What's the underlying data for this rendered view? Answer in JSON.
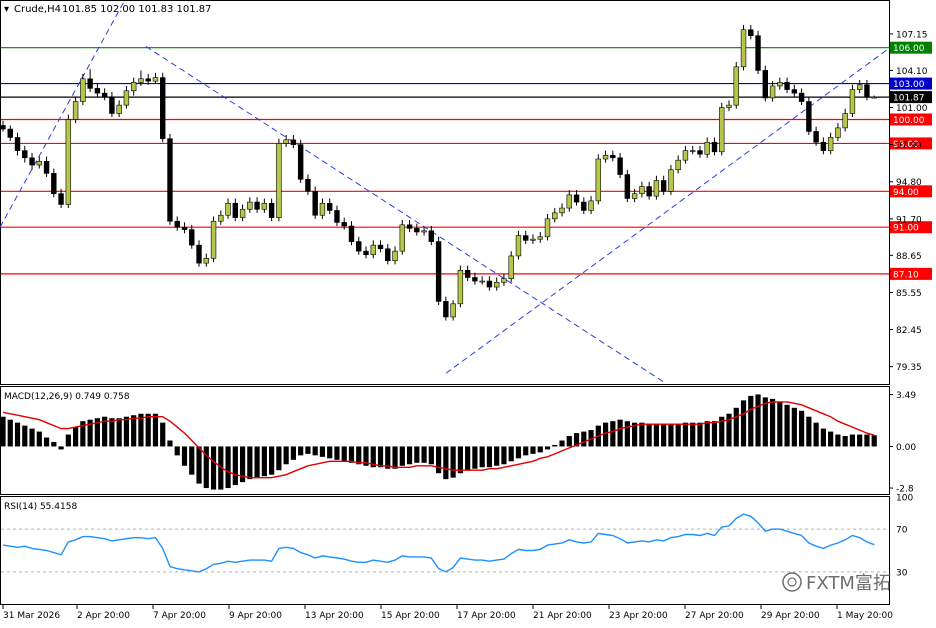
{
  "header": {
    "symbol": "Crude,H4",
    "ohlc": "101.85 102.00 101.83 101.87"
  },
  "watermark": "FXTM富拓",
  "colors": {
    "bull": "#b5c64a",
    "bear": "#000000",
    "support_line": "#ff0000",
    "top_line": "#008000",
    "blue_line": "#0000c8",
    "trend_line": "#2a3ee0",
    "macd_signal": "#e00000",
    "rsi": "#1e90ff"
  },
  "chart_data": [
    {
      "id": "price",
      "type": "candlestick",
      "ylim": [
        77.9,
        109.9
      ],
      "y_ticks": [
        "107.15",
        "104.10",
        "101.00",
        "97.90",
        "94.80",
        "91.70",
        "88.65",
        "85.55",
        "82.45",
        "79.35"
      ],
      "x_ticks": [
        "31 Mar 2026",
        "2 Apr 20:00",
        "7 Apr 20:00",
        "9 Apr 20:00",
        "13 Apr 20:00",
        "15 Apr 20:00",
        "17 Apr 20:00",
        "21 Apr 20:00",
        "23 Apr 20:00",
        "27 Apr 20:00",
        "29 Apr 20:00",
        "1 May 20:00"
      ],
      "close": [
        99.2,
        98.5,
        97.4,
        96.8,
        96.2,
        96.5,
        95.5,
        93.8,
        92.9,
        100.0,
        101.5,
        103.4,
        102.6,
        102.2,
        101.9,
        100.5,
        101.2,
        102.4,
        103.1,
        103.4,
        103.2,
        103.5,
        98.4,
        91.5,
        91.0,
        90.8,
        89.5,
        88.0,
        88.4,
        91.5,
        92.0,
        93.0,
        91.8,
        92.5,
        93.1,
        92.5,
        93.0,
        91.8,
        98.0,
        98.3,
        97.9,
        95.0,
        94.0,
        92.0,
        93.0,
        92.4,
        91.4,
        91.1,
        89.8,
        89.0,
        88.7,
        89.5,
        89.2,
        88.2,
        89.0,
        91.2,
        90.9,
        90.6,
        90.7,
        89.8,
        84.8,
        83.5,
        84.6,
        87.4,
        86.8,
        86.5,
        86.5,
        86.0,
        86.4,
        86.7,
        88.6,
        90.3,
        89.9,
        90.0,
        90.2,
        91.7,
        92.2,
        92.6,
        93.7,
        93.1,
        92.4,
        93.2,
        96.7,
        97.0,
        96.8,
        95.4,
        93.4,
        93.8,
        94.4,
        93.6,
        94.9,
        94.0,
        95.8,
        96.6,
        97.4,
        97.4,
        97.1,
        98.1,
        97.3,
        101.0,
        101.2,
        104.4,
        107.5,
        107.0,
        104.1,
        101.8,
        102.8,
        103.1,
        102.5,
        102.2,
        101.5,
        99.0,
        98.1,
        97.4,
        98.5,
        99.3,
        100.5,
        102.5,
        102.9,
        101.9,
        101.87
      ],
      "open": [
        99.5,
        99.2,
        98.5,
        97.4,
        96.8,
        96.2,
        96.5,
        95.5,
        93.8,
        92.9,
        100.0,
        101.5,
        103.4,
        102.6,
        102.2,
        101.9,
        100.5,
        101.2,
        102.4,
        103.1,
        103.4,
        103.2,
        103.5,
        98.4,
        91.5,
        91.0,
        90.8,
        89.5,
        88.0,
        88.4,
        91.5,
        92.0,
        93.0,
        91.8,
        92.5,
        93.1,
        92.5,
        93.0,
        91.8,
        98.0,
        98.3,
        97.9,
        95.0,
        94.0,
        92.0,
        93.0,
        92.4,
        91.4,
        91.1,
        89.8,
        89.0,
        88.7,
        89.5,
        89.2,
        88.2,
        89.0,
        91.2,
        90.9,
        90.6,
        90.7,
        89.8,
        84.8,
        83.5,
        84.6,
        87.4,
        86.8,
        86.5,
        86.5,
        86.0,
        86.4,
        86.7,
        88.6,
        90.3,
        89.9,
        90.0,
        90.2,
        91.7,
        92.2,
        92.6,
        93.7,
        93.1,
        92.4,
        93.2,
        96.7,
        97.0,
        96.8,
        95.4,
        93.4,
        93.8,
        94.4,
        93.6,
        94.9,
        94.0,
        95.8,
        96.6,
        97.4,
        97.4,
        97.1,
        98.1,
        97.3,
        101.0,
        101.2,
        104.4,
        107.5,
        107.0,
        104.1,
        101.8,
        102.8,
        103.1,
        102.5,
        102.2,
        101.5,
        99.0,
        98.1,
        97.4,
        98.5,
        99.3,
        100.5,
        102.5,
        102.9,
        101.85
      ],
      "high": [
        99.9,
        99.5,
        98.9,
        97.8,
        97.2,
        96.9,
        96.9,
        95.9,
        94.2,
        100.4,
        101.9,
        103.8,
        104.2,
        103.0,
        102.6,
        102.3,
        101.6,
        102.8,
        103.5,
        104.1,
        103.8,
        103.9,
        103.9,
        98.8,
        91.9,
        91.4,
        91.2,
        89.9,
        88.8,
        91.9,
        92.4,
        93.4,
        93.4,
        92.9,
        93.5,
        93.5,
        93.4,
        93.4,
        98.4,
        98.7,
        98.7,
        98.3,
        95.4,
        94.4,
        93.4,
        93.4,
        92.8,
        91.8,
        91.5,
        90.2,
        89.4,
        89.9,
        89.9,
        89.6,
        89.4,
        91.6,
        91.6,
        91.3,
        91.0,
        91.1,
        90.2,
        85.2,
        84.9,
        87.8,
        87.8,
        87.2,
        86.9,
        86.9,
        86.8,
        87.1,
        89.0,
        90.7,
        90.7,
        90.4,
        90.6,
        92.1,
        92.6,
        93.0,
        94.1,
        94.1,
        93.5,
        93.6,
        97.1,
        97.4,
        97.4,
        97.2,
        95.8,
        94.2,
        94.8,
        94.8,
        95.3,
        95.3,
        96.2,
        97.0,
        97.8,
        97.8,
        97.8,
        98.5,
        98.5,
        101.4,
        101.6,
        104.8,
        107.9,
        107.9,
        107.4,
        104.5,
        103.2,
        103.5,
        103.5,
        102.9,
        102.6,
        101.9,
        99.4,
        98.5,
        98.9,
        99.7,
        100.9,
        102.9,
        103.3,
        103.3,
        102.0
      ],
      "low": [
        99.0,
        98.2,
        97.0,
        96.4,
        95.8,
        95.9,
        95.2,
        93.5,
        92.6,
        92.6,
        99.7,
        101.2,
        102.3,
        101.9,
        101.6,
        100.2,
        100.2,
        100.9,
        102.0,
        102.8,
        102.9,
        103.0,
        98.1,
        91.2,
        90.7,
        90.5,
        89.2,
        87.7,
        87.7,
        88.1,
        91.2,
        91.7,
        91.5,
        91.5,
        92.2,
        92.2,
        92.2,
        91.5,
        91.5,
        97.7,
        97.6,
        94.7,
        93.7,
        91.7,
        91.7,
        92.1,
        91.1,
        90.8,
        89.5,
        88.7,
        88.4,
        88.4,
        88.9,
        87.9,
        87.9,
        88.7,
        90.6,
        90.3,
        90.3,
        89.5,
        84.5,
        83.2,
        83.2,
        84.3,
        86.5,
        86.2,
        86.2,
        85.7,
        85.7,
        86.1,
        86.4,
        88.3,
        89.6,
        89.6,
        89.7,
        89.9,
        91.4,
        91.9,
        92.3,
        92.8,
        92.1,
        92.1,
        92.9,
        96.4,
        96.5,
        95.1,
        93.1,
        93.1,
        93.5,
        93.3,
        93.3,
        93.7,
        93.7,
        95.5,
        96.3,
        97.1,
        96.8,
        96.8,
        97.0,
        97.0,
        100.7,
        100.9,
        104.1,
        106.7,
        103.8,
        101.5,
        101.5,
        102.5,
        102.2,
        101.9,
        101.2,
        98.7,
        97.8,
        97.1,
        97.1,
        98.2,
        99.0,
        100.2,
        102.2,
        101.6,
        101.83
      ],
      "h_levels": [
        {
          "label": "106.00",
          "value": 106.0,
          "color": "#008000"
        },
        {
          "label": "103.00",
          "value": 103.0,
          "color": "#0000c8"
        },
        {
          "label": "101.87",
          "value": 101.87,
          "color": "#000000"
        },
        {
          "label": "100.00",
          "value": 100.0,
          "color": "#ff0000"
        },
        {
          "label": "98.00",
          "value": 98.0,
          "color": "#ff0000"
        },
        {
          "label": "94.00",
          "value": 94.0,
          "color": "#ff0000"
        },
        {
          "label": "91.00",
          "value": 91.0,
          "color": "#ff0000"
        },
        {
          "label": "87.10",
          "value": 87.1,
          "color": "#ff0000"
        }
      ],
      "trendlines": [
        {
          "from": [
            0,
            91.0
          ],
          "to": [
            129,
            110.6
          ]
        },
        {
          "from": [
            146,
            106.1
          ],
          "to": [
            665,
            78.0
          ]
        },
        {
          "from": [
            446,
            78.8
          ],
          "to": [
            890,
            106.0
          ]
        }
      ]
    },
    {
      "id": "macd",
      "type": "bar+line",
      "title": "MACD(12,26,9) 0.749 0.758",
      "ylim": [
        -3.2,
        4.0
      ],
      "y_ticks": [
        "3.49",
        "0.00",
        "-2.8"
      ],
      "histogram": [
        2.0,
        1.8,
        1.6,
        1.4,
        1.2,
        1.0,
        0.6,
        0.3,
        -0.2,
        0.8,
        1.3,
        1.7,
        1.8,
        1.9,
        2.0,
        1.9,
        1.9,
        2.0,
        2.1,
        2.2,
        2.2,
        2.2,
        1.6,
        0.4,
        -0.6,
        -1.3,
        -1.9,
        -2.5,
        -2.8,
        -2.9,
        -2.9,
        -2.8,
        -2.6,
        -2.4,
        -2.2,
        -2.1,
        -2.0,
        -1.9,
        -1.6,
        -1.2,
        -0.9,
        -0.6,
        -0.5,
        -0.6,
        -0.7,
        -0.8,
        -0.9,
        -1.0,
        -1.1,
        -1.2,
        -1.3,
        -1.4,
        -1.4,
        -1.5,
        -1.5,
        -1.3,
        -1.2,
        -1.1,
        -1.1,
        -1.2,
        -1.8,
        -2.2,
        -2.1,
        -1.8,
        -1.6,
        -1.5,
        -1.4,
        -1.4,
        -1.3,
        -1.2,
        -1.0,
        -0.8,
        -0.6,
        -0.5,
        -0.4,
        -0.2,
        0.1,
        0.4,
        0.7,
        0.9,
        1.0,
        1.1,
        1.4,
        1.6,
        1.7,
        1.8,
        1.7,
        1.6,
        1.6,
        1.5,
        1.5,
        1.5,
        1.5,
        1.5,
        1.6,
        1.6,
        1.6,
        1.7,
        1.7,
        2.0,
        2.2,
        2.6,
        3.1,
        3.4,
        3.5,
        3.3,
        3.2,
        3.0,
        2.8,
        2.6,
        2.4,
        2.0,
        1.6,
        1.2,
        1.0,
        0.8,
        0.7,
        0.8,
        0.8,
        0.8,
        0.749
      ],
      "signal": [
        2.3,
        2.2,
        2.1,
        2.0,
        1.9,
        1.8,
        1.6,
        1.4,
        1.2,
        1.2,
        1.3,
        1.4,
        1.5,
        1.6,
        1.7,
        1.7,
        1.8,
        1.8,
        1.9,
        1.9,
        2.0,
        2.0,
        2.0,
        1.7,
        1.3,
        0.9,
        0.4,
        -0.1,
        -0.6,
        -1.0,
        -1.4,
        -1.7,
        -1.9,
        -2.0,
        -2.1,
        -2.1,
        -2.1,
        -2.1,
        -2.0,
        -1.9,
        -1.7,
        -1.5,
        -1.3,
        -1.2,
        -1.1,
        -1.0,
        -1.0,
        -1.0,
        -1.0,
        -1.1,
        -1.1,
        -1.2,
        -1.3,
        -1.3,
        -1.4,
        -1.4,
        -1.4,
        -1.3,
        -1.3,
        -1.3,
        -1.4,
        -1.5,
        -1.6,
        -1.6,
        -1.6,
        -1.6,
        -1.6,
        -1.5,
        -1.5,
        -1.4,
        -1.3,
        -1.2,
        -1.1,
        -1.0,
        -0.8,
        -0.7,
        -0.5,
        -0.3,
        -0.1,
        0.1,
        0.3,
        0.5,
        0.7,
        0.9,
        1.0,
        1.2,
        1.3,
        1.4,
        1.5,
        1.5,
        1.5,
        1.5,
        1.5,
        1.5,
        1.5,
        1.5,
        1.5,
        1.6,
        1.6,
        1.7,
        1.8,
        2.0,
        2.2,
        2.5,
        2.7,
        2.9,
        3.0,
        3.0,
        3.0,
        2.9,
        2.8,
        2.6,
        2.4,
        2.2,
        2.0,
        1.7,
        1.5,
        1.3,
        1.1,
        0.9,
        0.758
      ]
    },
    {
      "id": "rsi",
      "type": "line",
      "title": "RSI(14) 55.4158",
      "ylim": [
        0,
        100
      ],
      "y_ticks": [
        "100",
        "70",
        "30"
      ],
      "values": [
        55,
        54,
        53,
        54,
        52,
        51,
        50,
        48,
        46,
        58,
        60,
        63,
        63,
        62,
        61,
        59,
        60,
        61,
        62,
        62,
        61,
        62,
        52,
        35,
        33,
        32,
        31,
        30,
        33,
        37,
        38,
        40,
        39,
        40,
        41,
        41,
        41,
        40,
        52,
        53,
        52,
        48,
        46,
        43,
        45,
        44,
        43,
        42,
        40,
        39,
        39,
        41,
        40,
        39,
        41,
        45,
        44,
        44,
        44,
        43,
        33,
        30,
        34,
        43,
        42,
        41,
        41,
        40,
        41,
        42,
        47,
        51,
        50,
        50,
        51,
        55,
        56,
        57,
        60,
        58,
        57,
        58,
        66,
        65,
        64,
        61,
        57,
        58,
        59,
        58,
        60,
        59,
        62,
        63,
        65,
        65,
        64,
        66,
        64,
        72,
        73,
        80,
        84,
        82,
        76,
        68,
        70,
        70,
        68,
        66,
        64,
        57,
        54,
        52,
        55,
        57,
        60,
        64,
        62,
        58,
        55.4158
      ]
    }
  ]
}
